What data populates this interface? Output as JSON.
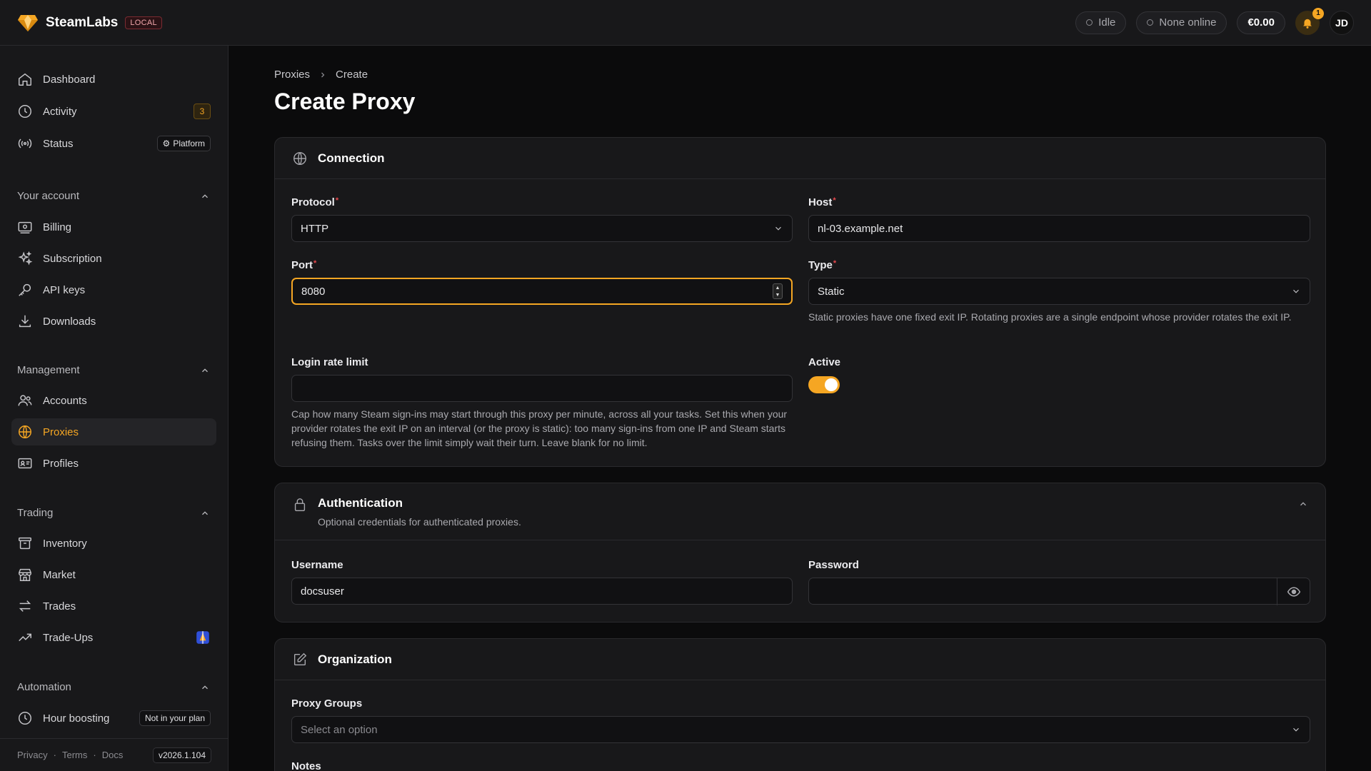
{
  "app": {
    "name": "SteamLabs",
    "env_badge": "LOCAL"
  },
  "topbar": {
    "status_idle": "Idle",
    "status_online": "None online",
    "balance": "€0.00",
    "notifications_count": "1",
    "avatar_initials": "JD"
  },
  "sidebar": {
    "top_items": [
      {
        "label": "Dashboard",
        "icon": "home-icon"
      },
      {
        "label": "Activity",
        "icon": "clock-icon",
        "badge": "3"
      },
      {
        "label": "Status",
        "icon": "broadcast-icon",
        "tag": "Platform"
      }
    ],
    "sections": [
      {
        "title": "Your account",
        "items": [
          {
            "label": "Billing",
            "icon": "billing-icon"
          },
          {
            "label": "Subscription",
            "icon": "sparkles-icon"
          },
          {
            "label": "API keys",
            "icon": "key-icon"
          },
          {
            "label": "Downloads",
            "icon": "download-icon"
          }
        ]
      },
      {
        "title": "Management",
        "items": [
          {
            "label": "Accounts",
            "icon": "users-icon"
          },
          {
            "label": "Proxies",
            "icon": "globe-icon",
            "active": true
          },
          {
            "label": "Profiles",
            "icon": "id-card-icon"
          }
        ]
      },
      {
        "title": "Trading",
        "items": [
          {
            "label": "Inventory",
            "icon": "archive-icon"
          },
          {
            "label": "Market",
            "icon": "store-icon"
          },
          {
            "label": "Trades",
            "icon": "swap-icon"
          },
          {
            "label": "Trade-Ups",
            "icon": "trend-up-icon"
          }
        ]
      },
      {
        "title": "Automation",
        "items": [
          {
            "label": "Hour boosting",
            "icon": "clock-icon",
            "tag": "Not in your plan"
          }
        ]
      }
    ],
    "footer": {
      "privacy": "Privacy",
      "terms": "Terms",
      "docs": "Docs",
      "version": "v2026.1.104",
      "sep": "·"
    }
  },
  "breadcrumb": {
    "parent": "Proxies",
    "current": "Create"
  },
  "page_title": "Create Proxy",
  "connection": {
    "title": "Connection",
    "protocol_label": "Protocol",
    "protocol_value": "HTTP",
    "host_label": "Host",
    "host_value": "nl-03.example.net",
    "port_label": "Port",
    "port_value": "8080",
    "type_label": "Type",
    "type_value": "Static",
    "type_help": "Static proxies have one fixed exit IP. Rotating proxies are a single endpoint whose provider rotates the exit IP.",
    "rate_label": "Login rate limit",
    "rate_value": "",
    "rate_help": "Cap how many Steam sign-ins may start through this proxy per minute, across all your tasks. Set this when your provider rotates the exit IP on an interval (or the proxy is static): too many sign-ins from one IP and Steam starts refusing them. Tasks over the limit simply wait their turn. Leave blank for no limit.",
    "active_label": "Active",
    "active_on": true,
    "required_mark": "*"
  },
  "authentication": {
    "title": "Authentication",
    "subtitle": "Optional credentials for authenticated proxies.",
    "username_label": "Username",
    "username_value": "docsuser",
    "password_label": "Password",
    "password_value": ""
  },
  "organization": {
    "title": "Organization",
    "groups_label": "Proxy Groups",
    "groups_placeholder": "Select an option",
    "notes_label": "Notes"
  },
  "colors": {
    "accent": "#f5a623",
    "required": "#e5484d"
  }
}
